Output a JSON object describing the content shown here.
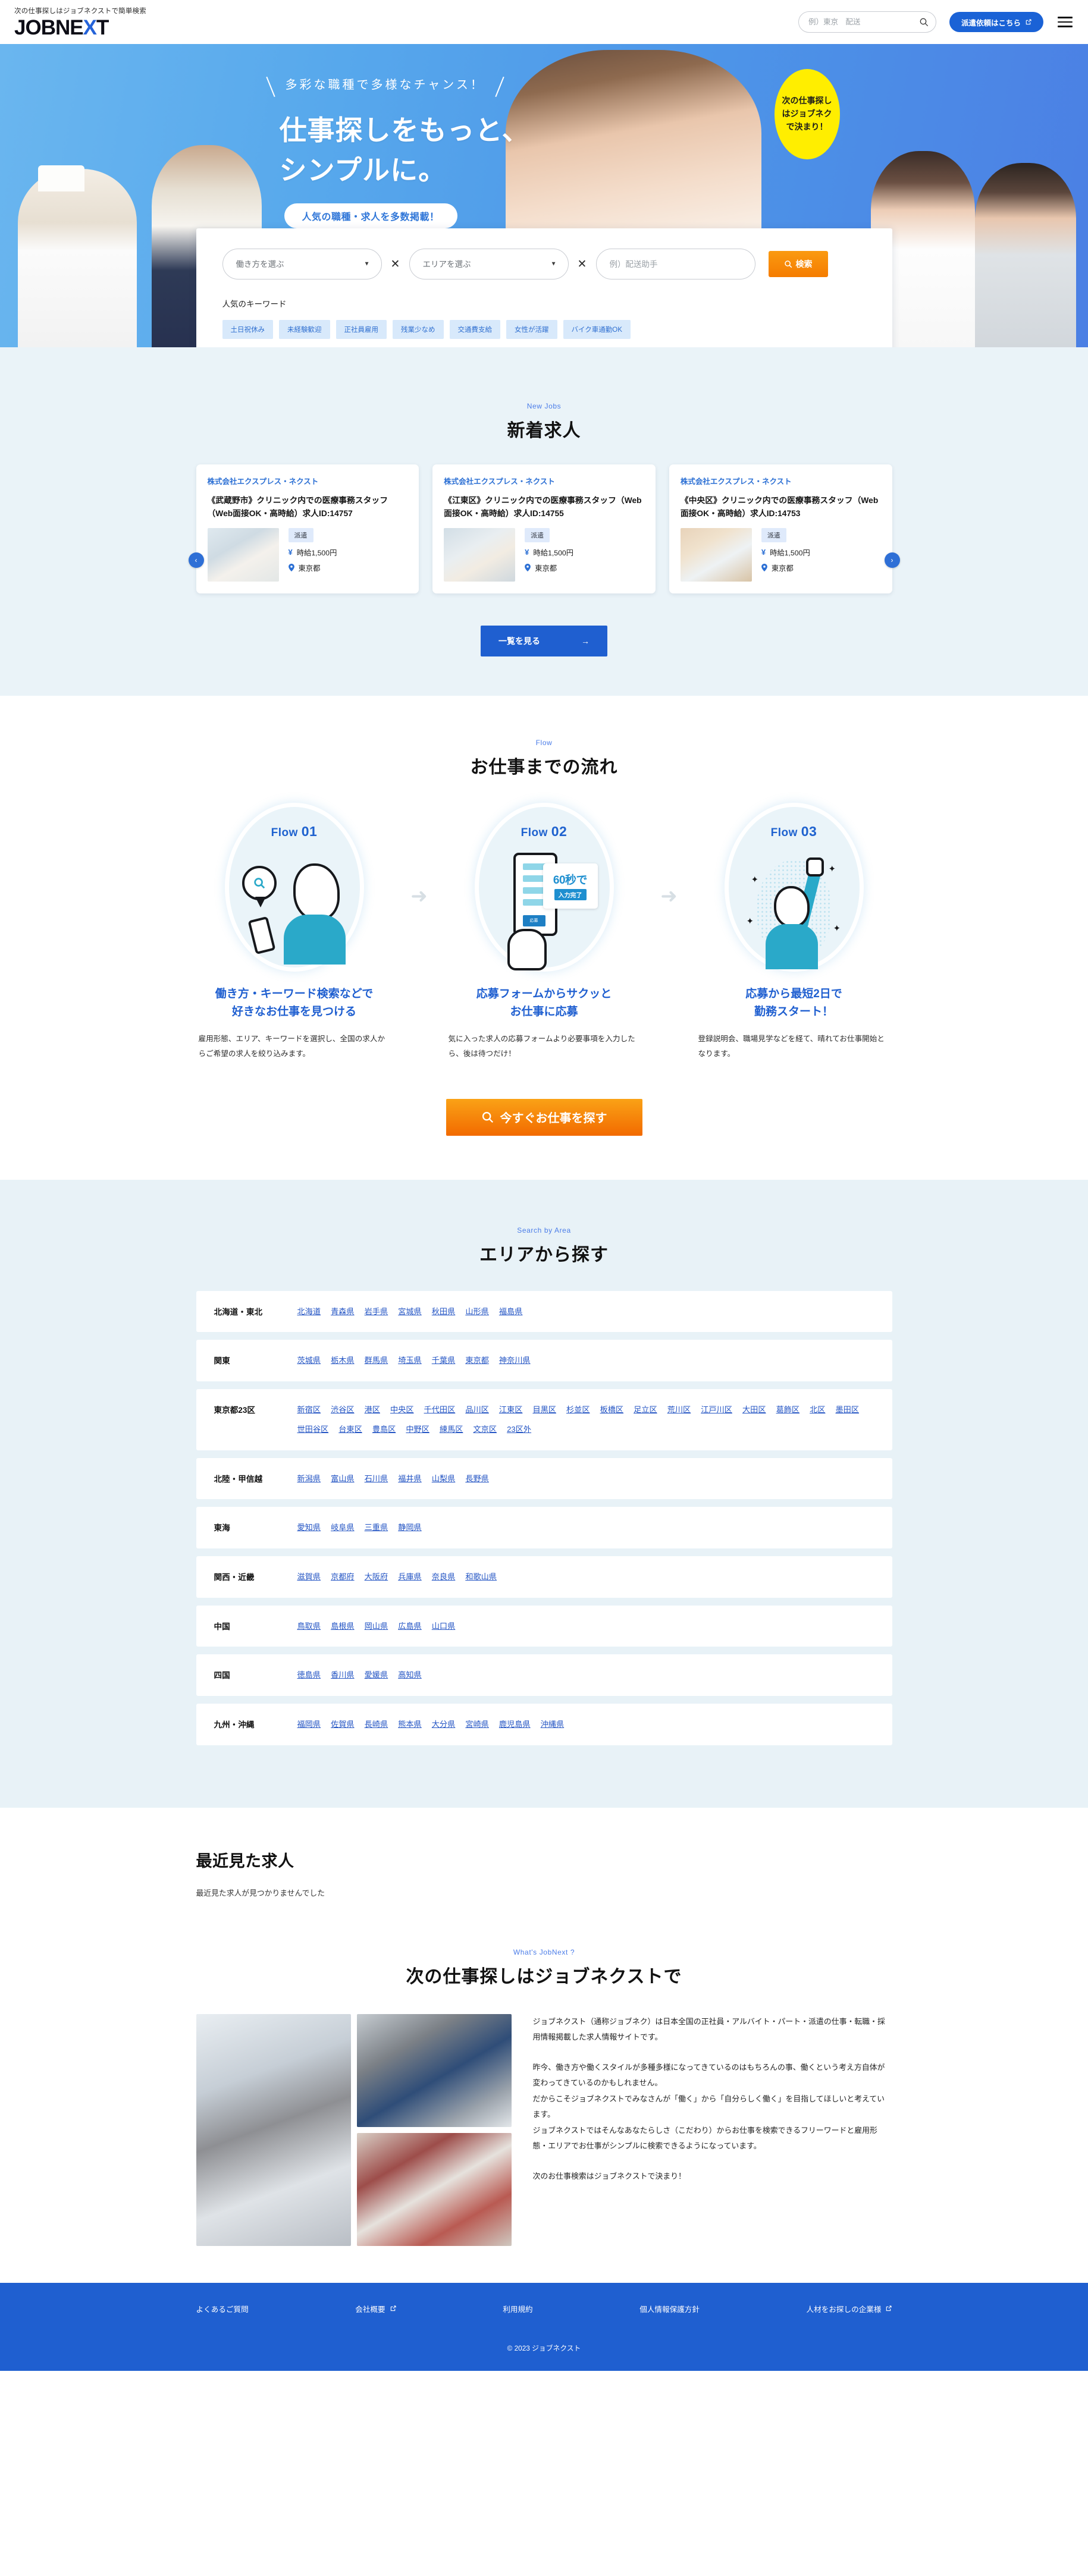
{
  "header": {
    "tagline": "次の仕事探しはジョブネクストで簡単検索",
    "logo_main": "JOBNE",
    "logo_x": "X",
    "logo_tail": "T",
    "search_placeholder": "例）東京　配送",
    "search_value": "",
    "dispatch_button": "派遣依頼はこちら"
  },
  "hero": {
    "eyebrow": "多彩な職種で多様なチャンス！",
    "title_line1": "仕事探しをもっと、",
    "title_line2": "シンプルに。",
    "pill": "人気の職種・求人を多数掲載！",
    "badge_line1": "次の仕事探し",
    "badge_line2": "はジョブネク",
    "badge_line3": "で決まり！"
  },
  "search_panel": {
    "worktype_selected": "働き方を選ぶ",
    "worktype_options": [
      "働き方を選ぶ"
    ],
    "area_selected": "エリアを選ぶ",
    "area_options": [
      "エリアを選ぶ"
    ],
    "keyword_placeholder": "例）配送助手",
    "keyword_value": "",
    "cross": "✕",
    "search_button": "検索",
    "popular_heading": "人気のキーワード",
    "popular_tags": [
      "土日祝休み",
      "未経験歓迎",
      "正社員雇用",
      "残業少なめ",
      "交通費支給",
      "女性が活躍",
      "バイク車通勤OK"
    ]
  },
  "new_jobs": {
    "eyebrow": "New Jobs",
    "title": "新着求人",
    "prev": "‹",
    "next": "›",
    "more_button": "一覧を見る",
    "more_arrow": "→",
    "cards": [
      {
        "company": "株式会社エクスプレス・ネクスト",
        "title": "《武蔵野市》クリニック内での医療事務スタッフ（Web面接OK・高時給）求人ID:14757",
        "badge": "派遣",
        "salary": "時給1,500円",
        "location": "東京都"
      },
      {
        "company": "株式会社エクスプレス・ネクスト",
        "title": "《江東区》クリニック内での医療事務スタッフ（Web面接OK・高時給）求人ID:14755",
        "badge": "派遣",
        "salary": "時給1,500円",
        "location": "東京都"
      },
      {
        "company": "株式会社エクスプレス・ネクスト",
        "title": "《中央区》クリニック内での医療事務スタッフ（Web面接OK・高時給）求人ID:14753",
        "badge": "派遣",
        "salary": "時給1,500円",
        "location": "東京都"
      }
    ]
  },
  "flow": {
    "eyebrow": "Flow",
    "title": "お仕事までの流れ",
    "arrow": "➜",
    "steps": [
      {
        "label_pre": "Flow ",
        "label_num": "01",
        "heading": "働き方・キーワード検索などで\n好きなお仕事を見つける",
        "desc": "雇用形態、エリア、キーワードを選択し、全国の求人からご希望の求人を絞り込みます。"
      },
      {
        "label_pre": "Flow ",
        "label_num": "02",
        "heading": "応募フォームからサクッと\nお仕事に応募",
        "desc": "気に入った求人の応募フォームより必要事項を入力したら、後は待つだけ！",
        "art_big": "60秒で",
        "art_small": "入力完了",
        "art_btn": "応募"
      },
      {
        "label_pre": "Flow ",
        "label_num": "03",
        "heading": "応募から最短2日で\n勤務スタート！",
        "desc": "登録説明会、職場見学などを経て、晴れてお仕事開始となります。"
      }
    ],
    "cta_button": "今すぐお仕事を探す"
  },
  "area": {
    "eyebrow": "Search by Area",
    "title": "エリアから探す",
    "rows": [
      {
        "name": "北海道・東北",
        "links": [
          "北海道",
          "青森県",
          "岩手県",
          "宮城県",
          "秋田県",
          "山形県",
          "福島県"
        ]
      },
      {
        "name": "関東",
        "links": [
          "茨城県",
          "栃木県",
          "群馬県",
          "埼玉県",
          "千葉県",
          "東京都",
          "神奈川県"
        ]
      },
      {
        "name": "東京都23区",
        "links": [
          "新宿区",
          "渋谷区",
          "港区",
          "中央区",
          "千代田区",
          "品川区",
          "江東区",
          "目黒区",
          "杉並区",
          "板橋区",
          "足立区",
          "荒川区",
          "江戸川区",
          "大田区",
          "葛飾区",
          "北区",
          "墨田区",
          "世田谷区",
          "台東区",
          "豊島区",
          "中野区",
          "練馬区",
          "文京区",
          "23区外"
        ]
      },
      {
        "name": "北陸・甲信越",
        "links": [
          "新潟県",
          "富山県",
          "石川県",
          "福井県",
          "山梨県",
          "長野県"
        ]
      },
      {
        "name": "東海",
        "links": [
          "愛知県",
          "岐阜県",
          "三重県",
          "静岡県"
        ]
      },
      {
        "name": "関西・近畿",
        "links": [
          "滋賀県",
          "京都府",
          "大阪府",
          "兵庫県",
          "奈良県",
          "和歌山県"
        ]
      },
      {
        "name": "中国",
        "links": [
          "鳥取県",
          "島根県",
          "岡山県",
          "広島県",
          "山口県"
        ]
      },
      {
        "name": "四国",
        "links": [
          "徳島県",
          "香川県",
          "愛媛県",
          "高知県"
        ]
      },
      {
        "name": "九州・沖縄",
        "links": [
          "福岡県",
          "佐賀県",
          "長崎県",
          "熊本県",
          "大分県",
          "宮崎県",
          "鹿児島県",
          "沖縄県"
        ]
      }
    ]
  },
  "recent": {
    "title": "最近見た求人",
    "empty_message": "最近見た求人が見つかりませんでした"
  },
  "what": {
    "eyebrow": "What's JobNext ?",
    "title": "次の仕事探しはジョブネクストで",
    "paragraphs": [
      "ジョブネクスト（通称ジョブネク）は日本全国の正社員・アルバイト・パート・派遣の仕事・転職・採用情報掲載した求人情報サイトです。",
      "昨今、働き方や働くスタイルが多種多様になってきているのはもちろんの事、働くという考え方自体が変わってきているのかもしれません。\nだからこそジョブネクストでみなさんが「働く」から「自分らしく働く」を目指してほしいと考えています。\nジョブネクストではそんなあなたらしさ（こだわり）からお仕事を検索できるフリーワードと雇用形態・エリアでお仕事がシンプルに検索できるようになっています。",
      "次のお仕事検索はジョブネクストで決まり！"
    ]
  },
  "footer": {
    "links": [
      {
        "label": "よくあるご質問",
        "external": false
      },
      {
        "label": "会社概要",
        "external": true
      },
      {
        "label": "利用規約",
        "external": false
      },
      {
        "label": "個人情報保護方針",
        "external": false
      },
      {
        "label": "人材をお探しの企業様",
        "external": true
      }
    ],
    "copyright": "© 2023 ジョブネクスト"
  },
  "colors": {
    "brand_blue": "#1f5fd0",
    "accent_orange": "#f57c00",
    "badge_yellow": "#ffee00",
    "link_blue": "#2455c4",
    "section_bg": "#e8f2f7"
  }
}
